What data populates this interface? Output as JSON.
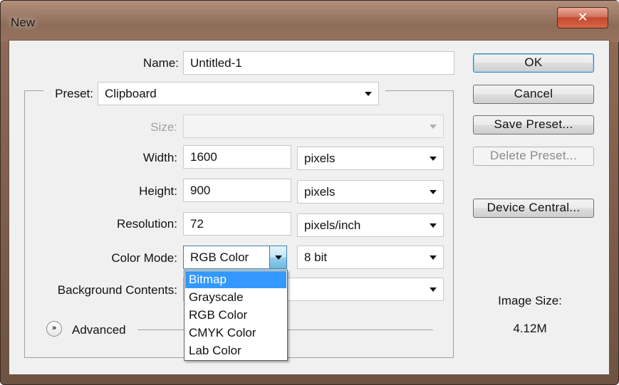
{
  "window": {
    "title": "New",
    "close_glyph": "✕"
  },
  "form": {
    "name_label": "Name:",
    "name_value": "Untitled-1",
    "preset_label": "Preset:",
    "preset_value": "Clipboard",
    "size_label": "Size:",
    "size_value": "",
    "width_label": "Width:",
    "width_value": "1600",
    "width_unit": "pixels",
    "height_label": "Height:",
    "height_value": "900",
    "height_unit": "pixels",
    "resolution_label": "Resolution:",
    "resolution_value": "72",
    "resolution_unit": "pixels/inch",
    "color_mode_label": "Color Mode:",
    "color_mode_value": "RGB Color",
    "bit_depth_value": "8 bit",
    "background_label": "Background Contents:",
    "background_value": "",
    "advanced_label": "Advanced"
  },
  "color_mode_menu": {
    "options": [
      "Bitmap",
      "Grayscale",
      "RGB Color",
      "CMYK Color",
      "Lab Color"
    ],
    "highlighted": "Bitmap"
  },
  "buttons": {
    "ok": "OK",
    "cancel": "Cancel",
    "save_preset": "Save Preset...",
    "delete_preset": "Delete Preset...",
    "device_central": "Device Central..."
  },
  "image_size": {
    "label": "Image Size:",
    "value": "4.12M"
  },
  "icons": {
    "close": "close-icon",
    "dropdown": "chevron-down-icon",
    "advanced": "double-chevron-down-icon"
  },
  "colors": {
    "accent": "#3399ff",
    "titlebar": "#8c6a56",
    "close": "#c24a2e"
  }
}
